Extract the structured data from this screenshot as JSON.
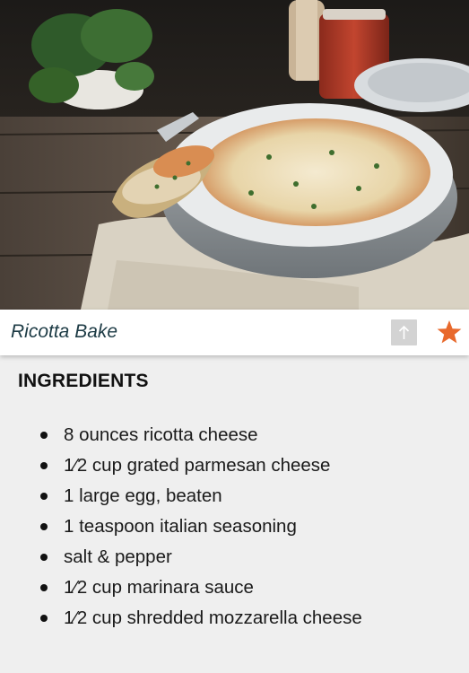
{
  "recipe": {
    "title": "Ricotta Bake"
  },
  "actions": {
    "share_icon": "arrow-up-icon",
    "favorite_icon": "star-icon",
    "favorite_active": true
  },
  "ingredients": {
    "heading": "INGREDIENTS",
    "items": [
      "8 ounces ricotta cheese",
      "1⁄2 cup grated parmesan cheese",
      "1 large egg, beaten",
      "1 teaspoon italian seasoning",
      "salt & pepper",
      "1⁄2 cup marinara sauce",
      "1⁄2 cup shredded mozzarella cheese"
    ]
  },
  "colors": {
    "title_text": "#1d3b45",
    "favorite_star": "#e8692c",
    "share_button_bg": "#d3d3d3",
    "page_background": "#efefef"
  }
}
